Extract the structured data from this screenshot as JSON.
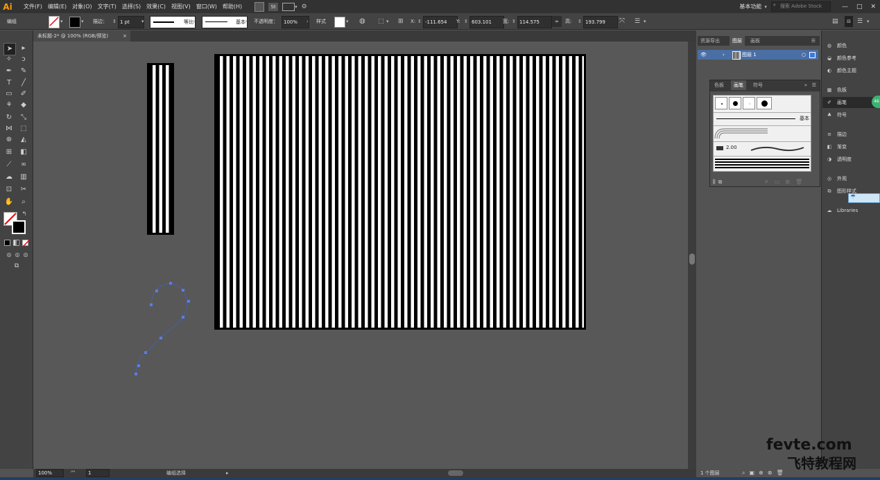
{
  "app": {
    "logo": "Ai"
  },
  "menu": [
    "文件(F)",
    "编辑(E)",
    "对象(O)",
    "文字(T)",
    "选择(S)",
    "效果(C)",
    "视图(V)",
    "窗口(W)",
    "帮助(H)"
  ],
  "menu_extra": {
    "st": "St",
    "workspace": "基本功能",
    "search_placeholder": "搜索 Adobe Stock"
  },
  "control": {
    "mode": "编组",
    "stroke_label": "描边：",
    "stroke_value": "1 pt",
    "profile_label": "等比",
    "brush_label": "基本",
    "opacity_label": "不透明度：",
    "opacity_value": "100%",
    "style_label": "样式",
    "x_label": "X:",
    "x_value": "-111.654",
    "y_label": "Y:",
    "y_value": "603.101",
    "w_label": "宽:",
    "w_value": "114.575",
    "h_label": "高:",
    "h_value": "193.799"
  },
  "document": {
    "tab_title": "未标题-2* @ 100% (RGB/预览)",
    "close": "×"
  },
  "status": {
    "zoom": "100%",
    "page": "1",
    "tool": "编组选择"
  },
  "layers_panel": {
    "tabs": [
      "资源导出",
      "图层",
      "画板"
    ],
    "layer_name": "图层 1",
    "footer": "1 个图层"
  },
  "brush_panel": {
    "tabs": [
      "色板",
      "画笔",
      "符号"
    ],
    "basic_label": "基本",
    "size_label": "2.00"
  },
  "dock": {
    "items": [
      "颜色",
      "颜色参考",
      "颜色主题",
      "色板",
      "画笔",
      "符号",
      "描边",
      "渐变",
      "透明度",
      "外观",
      "图形样式",
      "Libraries"
    ]
  },
  "watermark": {
    "line1": "fevte.com",
    "line2": "飞特教程网"
  },
  "badge": "46"
}
